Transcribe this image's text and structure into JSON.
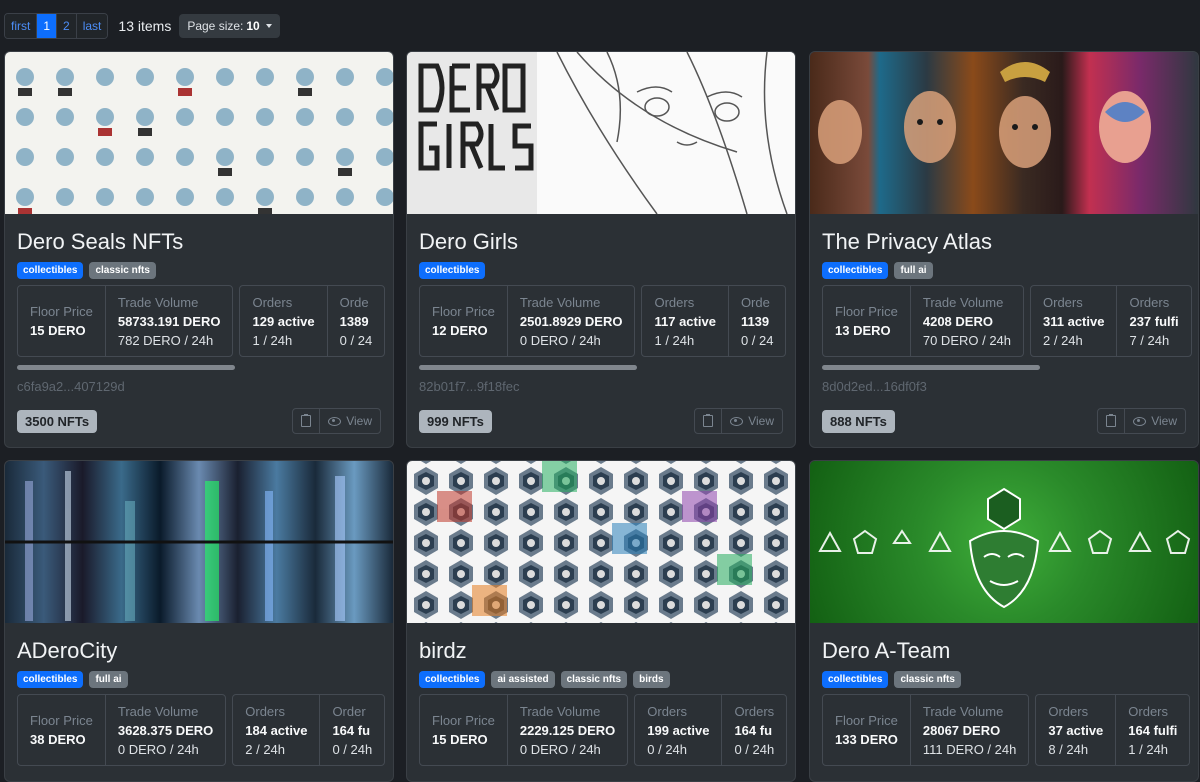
{
  "pagination": {
    "first": "first",
    "pages": [
      "1",
      "2"
    ],
    "last": "last",
    "items_count": "13 items",
    "page_size_label": "Page size:",
    "page_size_value": "10"
  },
  "labels": {
    "floor_price": "Floor Price",
    "trade_volume": "Trade Volume",
    "orders": "Orders",
    "view": "View"
  },
  "collections": [
    {
      "title": "Dero Seals NFTs",
      "tags": [
        "collectibles",
        "classic nfts"
      ],
      "floor": "15 DERO",
      "volume_total": "58733.191 DERO",
      "volume_24h": "782 DERO / 24h",
      "orders_active": "129 active",
      "orders_24h": "1 / 24h",
      "orders2_label": "Orde",
      "orders2_value": "1389",
      "orders2_24h": "0 / 24",
      "address": "c6fa9a2...407129d",
      "nft_count": "3500 NFTs"
    },
    {
      "title": "Dero Girls",
      "tags": [
        "collectibles"
      ],
      "floor": "12 DERO",
      "volume_total": "2501.8929 DERO",
      "volume_24h": "0 DERO / 24h",
      "orders_active": "117 active",
      "orders_24h": "1 / 24h",
      "orders2_label": "Orde",
      "orders2_value": "1139",
      "orders2_24h": "0 / 24",
      "address": "82b01f7...9f18fec",
      "nft_count": "999 NFTs"
    },
    {
      "title": "The Privacy Atlas",
      "tags": [
        "collectibles",
        "full ai"
      ],
      "floor": "13 DERO",
      "volume_total": "4208 DERO",
      "volume_24h": "70 DERO / 24h",
      "orders_active": "311 active",
      "orders_24h": "2 / 24h",
      "orders2_label": "Orders",
      "orders2_value": "237 fulfi",
      "orders2_24h": "7 / 24h",
      "address": "8d0d2ed...16df0f3",
      "nft_count": "888 NFTs"
    },
    {
      "title": "ADeroCity",
      "tags": [
        "collectibles",
        "full ai"
      ],
      "floor": "38 DERO",
      "volume_total": "3628.375 DERO",
      "volume_24h": "0 DERO / 24h",
      "orders_active": "184 active",
      "orders_24h": "2 / 24h",
      "orders2_label": "Order",
      "orders2_value": "164 fu",
      "orders2_24h": "0 / 24h"
    },
    {
      "title": "birdz",
      "tags": [
        "collectibles",
        "ai assisted",
        "classic nfts",
        "birds"
      ],
      "floor": "15 DERO",
      "volume_total": "2229.125 DERO",
      "volume_24h": "0 DERO / 24h",
      "orders_active": "199 active",
      "orders_24h": "0 / 24h",
      "orders2_label": "Orders",
      "orders2_value": "164 fu",
      "orders2_24h": "0 / 24h"
    },
    {
      "title": "Dero A-Team",
      "tags": [
        "collectibles",
        "classic nfts"
      ],
      "floor": "133 DERO",
      "volume_total": "28067 DERO",
      "volume_24h": "111 DERO / 24h",
      "orders_active": "37 active",
      "orders_24h": "8 / 24h",
      "orders2_label": "Orders",
      "orders2_value": "164 fulfi",
      "orders2_24h": "1 / 24h"
    }
  ],
  "colors": {
    "page_bg": "#1c1f24",
    "card_bg": "#2b3035",
    "primary": "#0d6efd",
    "secondary_tag": "#6c757d"
  }
}
